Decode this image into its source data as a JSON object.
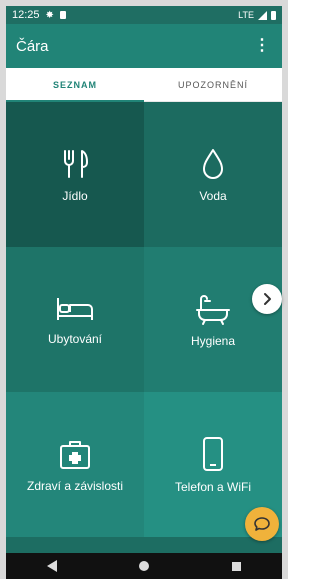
{
  "status_bar": {
    "time": "12:25",
    "network": "LTE"
  },
  "app_bar": {
    "title": "Čára",
    "menu_icon": "more-vert-icon"
  },
  "tabs": [
    {
      "label": "SEZNAM",
      "active": true
    },
    {
      "label": "UPOZORNĚNÍ",
      "active": false
    }
  ],
  "categories": [
    {
      "label": "Jídlo",
      "icon": "fork-knife-icon",
      "color": "#16584f"
    },
    {
      "label": "Voda",
      "icon": "water-drop-icon",
      "color": "#1c6b60"
    },
    {
      "label": "Ubytování",
      "icon": "bed-icon",
      "color": "#1e7468"
    },
    {
      "label": "Hygiena",
      "icon": "bathtub-icon",
      "color": "#217d71"
    },
    {
      "label": "Zdraví a závislosti",
      "icon": "first-aid-kit-icon",
      "color": "#23867a"
    },
    {
      "label": "Telefon a WiFi",
      "icon": "smartphone-icon",
      "color": "#259083"
    }
  ],
  "colors": {
    "accent": "#218477",
    "fab": "#f0b23b"
  }
}
